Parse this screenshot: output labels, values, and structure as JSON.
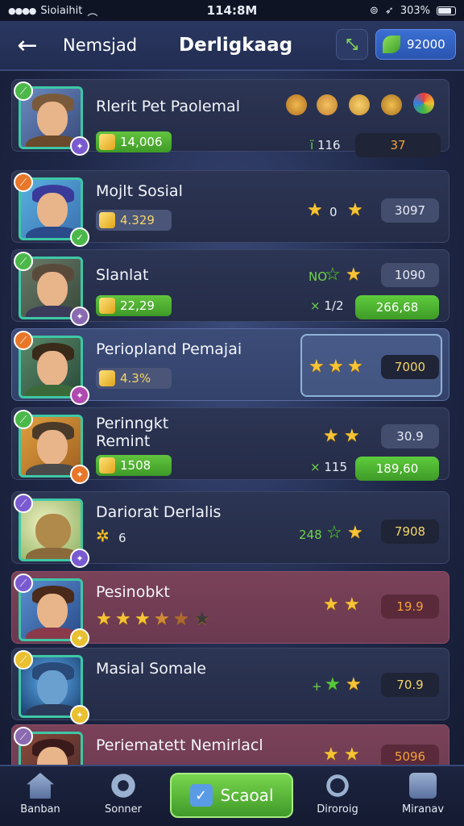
{
  "status": {
    "carrier": "Sioiaihit",
    "time": "114:8M",
    "battery": "303%"
  },
  "header": {
    "back_label": "←",
    "left_title": "Nemsjad",
    "title": "Derligkaag",
    "currency_value": "92000"
  },
  "rows": [
    {
      "name": "Rlerit Pet Paolemal",
      "pill": "14,006",
      "right_small": "116",
      "right_small_prefix": "ı̈",
      "box": "37"
    },
    {
      "name": "Mojlt Sosial",
      "pill": "4.329",
      "stars_text": "0",
      "box": "3097"
    },
    {
      "name": "Slanlat",
      "pill": "22,29",
      "small_top": "NO",
      "box_top": "1090",
      "right_small": "1/2",
      "box": "266,68"
    },
    {
      "name": "Periopland Pemajai",
      "pill": "4.3%",
      "box": "7000"
    },
    {
      "name": "Perinngkt Remint",
      "pill": "1508",
      "box_top": "30.9",
      "right_small": "115",
      "box": "189,60"
    },
    {
      "name": "Dariorat Derlalis",
      "pill_text": "6",
      "small_mid": "248",
      "box": "7908"
    },
    {
      "name": "Pesinobkt",
      "box": "19.9"
    },
    {
      "name": "Masial Somale",
      "small_mid": "+",
      "box": "70.9"
    },
    {
      "name": "Periematett Nemirlacl",
      "box": "5096"
    }
  ],
  "nav": [
    {
      "label": "Banban"
    },
    {
      "label": "Sonner"
    },
    {
      "label": "Scaoal"
    },
    {
      "label": "Diroroig"
    },
    {
      "label": "Miranav"
    }
  ]
}
